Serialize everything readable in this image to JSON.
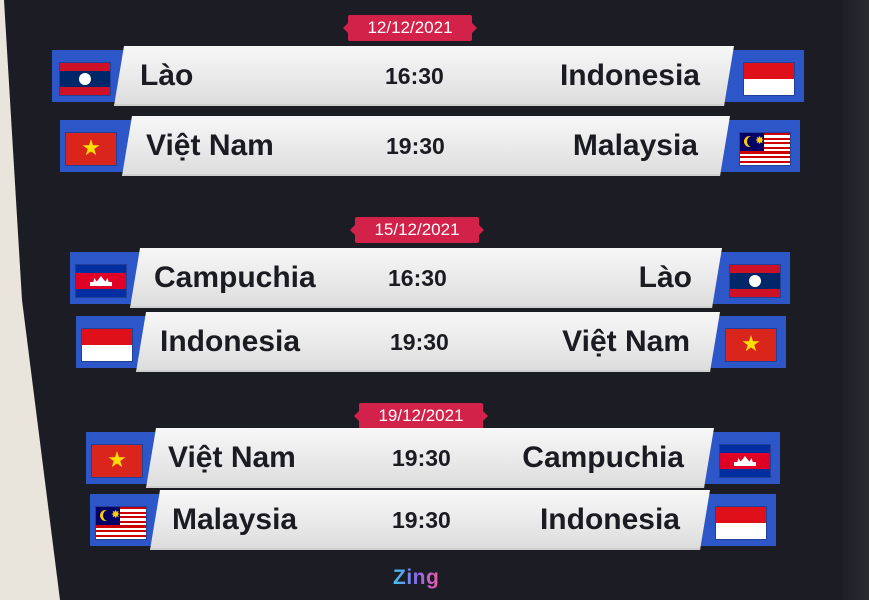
{
  "matchdays": [
    {
      "date": "12/12/2021",
      "matches": [
        {
          "home": "Lào",
          "time": "16:30",
          "away": "Indonesia",
          "home_flag": "laos-flag-icon",
          "away_flag": "indonesia-flag-icon"
        },
        {
          "home": "Việt Nam",
          "time": "19:30",
          "away": "Malaysia",
          "home_flag": "vietnam-flag-icon",
          "away_flag": "malaysia-flag-icon"
        }
      ]
    },
    {
      "date": "15/12/2021",
      "matches": [
        {
          "home": "Campuchia",
          "time": "16:30",
          "away": "Lào",
          "home_flag": "cambodia-flag-icon",
          "away_flag": "laos-flag-icon"
        },
        {
          "home": "Indonesia",
          "time": "19:30",
          "away": "Việt Nam",
          "home_flag": "indonesia-flag-icon",
          "away_flag": "vietnam-flag-icon"
        }
      ]
    },
    {
      "date": "19/12/2021",
      "matches": [
        {
          "home": "Việt Nam",
          "time": "19:30",
          "away": "Campuchia",
          "home_flag": "vietnam-flag-icon",
          "away_flag": "cambodia-flag-icon"
        },
        {
          "home": "Malaysia",
          "time": "19:30",
          "away": "Indonesia",
          "home_flag": "malaysia-flag-icon",
          "away_flag": "indonesia-flag-icon"
        }
      ]
    }
  ],
  "logo": "Zing",
  "colors": {
    "board": "#1c1c24",
    "band_blue": "#2d56c8",
    "date_badge": "#d3224a",
    "bar": "#eeeeee",
    "text": "#1b1b22"
  }
}
